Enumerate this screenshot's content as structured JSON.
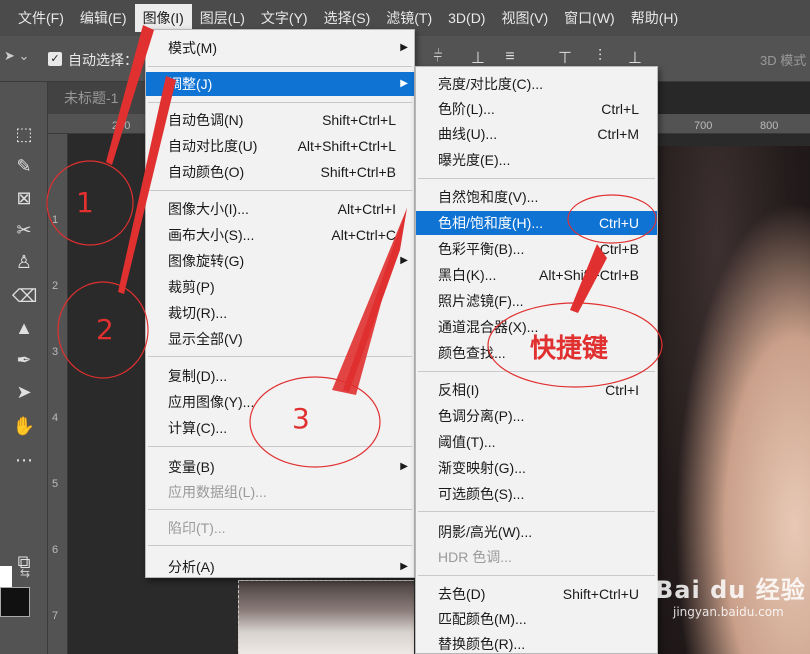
{
  "menubar": {
    "items": [
      {
        "label": "文件(F)"
      },
      {
        "label": "编辑(E)"
      },
      {
        "label": "图像(I)"
      },
      {
        "label": "图层(L)"
      },
      {
        "label": "文字(Y)"
      },
      {
        "label": "选择(S)"
      },
      {
        "label": "滤镜(T)"
      },
      {
        "label": "3D(D)"
      },
      {
        "label": "视图(V)"
      },
      {
        "label": "窗口(W)"
      },
      {
        "label": "帮助(H)"
      }
    ]
  },
  "options": {
    "auto_select_label": "自动选择：",
    "mode_3d": "3D 模式"
  },
  "document": {
    "tab_title": "未标题-1",
    "ruler_h": [
      "200",
      "700",
      "800"
    ],
    "ruler_v": [
      "1",
      "2",
      "3",
      "4",
      "5",
      "6",
      "7"
    ]
  },
  "image_menu": {
    "items": [
      {
        "label": "模式(M)",
        "shortcut": "",
        "submenu": true
      },
      {
        "label": "调整(J)",
        "shortcut": "",
        "submenu": true,
        "highlighted": true
      },
      {
        "label": "自动色调(N)",
        "shortcut": "Shift+Ctrl+L"
      },
      {
        "label": "自动对比度(U)",
        "shortcut": "Alt+Shift+Ctrl+L"
      },
      {
        "label": "自动颜色(O)",
        "shortcut": "Shift+Ctrl+B"
      },
      {
        "label": "图像大小(I)...",
        "shortcut": "Alt+Ctrl+I"
      },
      {
        "label": "画布大小(S)...",
        "shortcut": "Alt+Ctrl+C"
      },
      {
        "label": "图像旋转(G)",
        "shortcut": "",
        "submenu": true
      },
      {
        "label": "裁剪(P)",
        "shortcut": ""
      },
      {
        "label": "裁切(R)...",
        "shortcut": ""
      },
      {
        "label": "显示全部(V)",
        "shortcut": ""
      },
      {
        "label": "复制(D)...",
        "shortcut": ""
      },
      {
        "label": "应用图像(Y)...",
        "shortcut": ""
      },
      {
        "label": "计算(C)...",
        "shortcut": ""
      },
      {
        "label": "变量(B)",
        "shortcut": "",
        "submenu": true
      },
      {
        "label": "应用数据组(L)...",
        "shortcut": "",
        "disabled": true
      },
      {
        "label": "陷印(T)...",
        "shortcut": "",
        "disabled": true
      },
      {
        "label": "分析(A)",
        "shortcut": "",
        "submenu": true
      }
    ]
  },
  "adjust_menu": {
    "items": [
      {
        "label": "亮度/对比度(C)...",
        "shortcut": ""
      },
      {
        "label": "色阶(L)...",
        "shortcut": "Ctrl+L"
      },
      {
        "label": "曲线(U)...",
        "shortcut": "Ctrl+M"
      },
      {
        "label": "曝光度(E)...",
        "shortcut": ""
      },
      {
        "label": "自然饱和度(V)...",
        "shortcut": ""
      },
      {
        "label": "色相/饱和度(H)...",
        "shortcut": "Ctrl+U",
        "highlighted": true
      },
      {
        "label": "色彩平衡(B)...",
        "shortcut": "Ctrl+B"
      },
      {
        "label": "黑白(K)...",
        "shortcut": "Alt+Shift+Ctrl+B"
      },
      {
        "label": "照片滤镜(F)...",
        "shortcut": ""
      },
      {
        "label": "通道混合器(X)...",
        "shortcut": ""
      },
      {
        "label": "颜色查找...",
        "shortcut": ""
      },
      {
        "label": "反相(I)",
        "shortcut": "Ctrl+I"
      },
      {
        "label": "色调分离(P)...",
        "shortcut": ""
      },
      {
        "label": "阈值(T)...",
        "shortcut": ""
      },
      {
        "label": "渐变映射(G)...",
        "shortcut": ""
      },
      {
        "label": "可选颜色(S)...",
        "shortcut": ""
      },
      {
        "label": "阴影/高光(W)...",
        "shortcut": ""
      },
      {
        "label": "HDR 色调...",
        "shortcut": "",
        "disabled": true
      },
      {
        "label": "去色(D)",
        "shortcut": "Shift+Ctrl+U"
      },
      {
        "label": "匹配颜色(M)...",
        "shortcut": ""
      },
      {
        "label": "替换颜色(R)...",
        "shortcut": ""
      }
    ]
  },
  "annotations": {
    "step1": "1",
    "step2": "2",
    "step3": "3",
    "shortcut_note": "快捷键",
    "color": "#e03030"
  },
  "watermark": {
    "main": "Bai du 经验",
    "sub": "jingyan.baidu.com"
  },
  "colors": {
    "highlight": "#0f73d4",
    "menubar": "#4b4b4b",
    "panel": "#535353"
  }
}
